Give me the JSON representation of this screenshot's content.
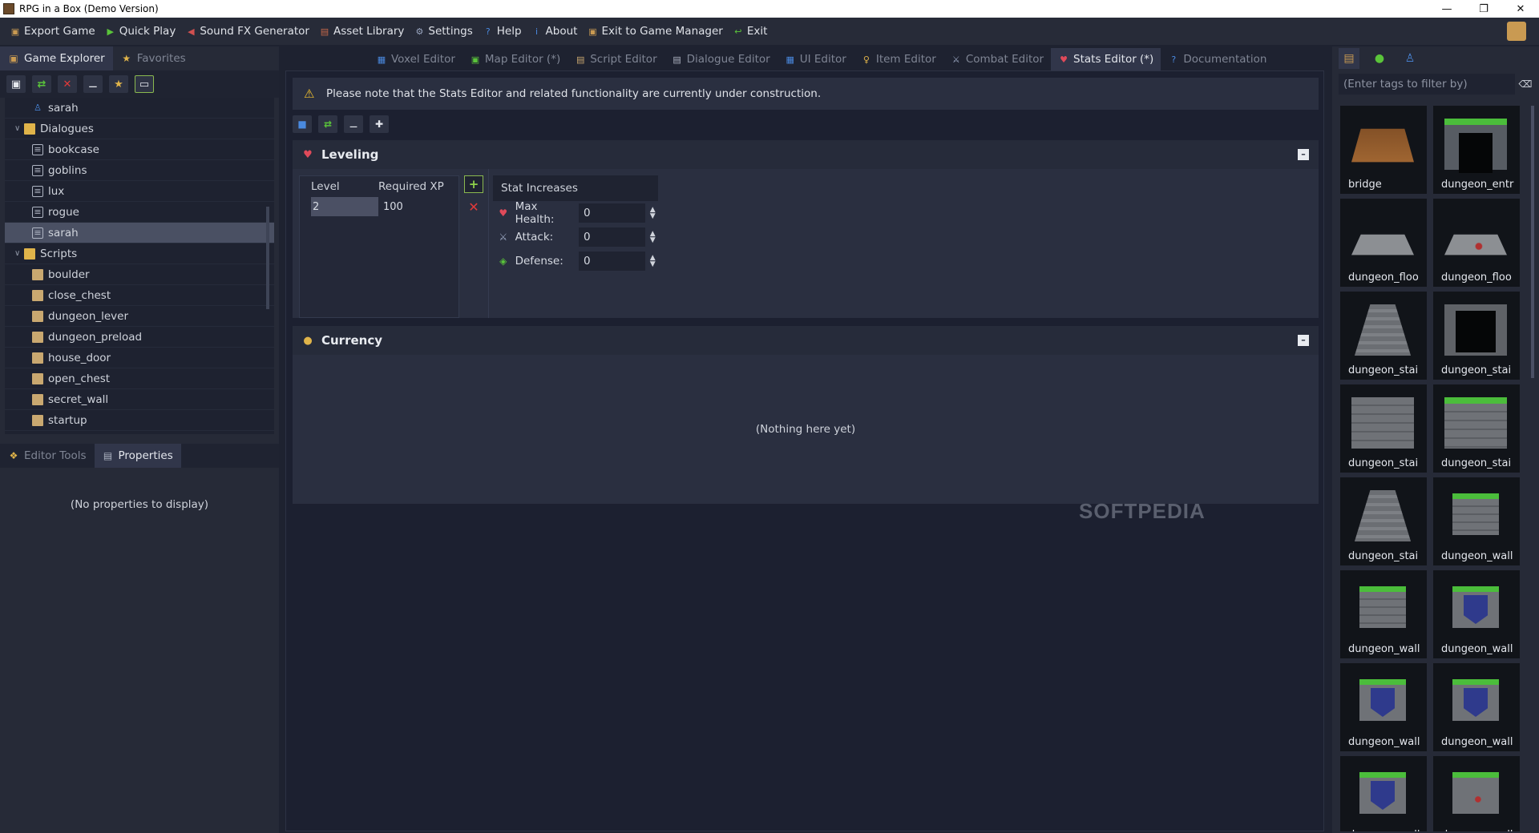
{
  "window": {
    "title": "RPG in a Box (Demo Version)",
    "minimize": "—",
    "maximize": "❐",
    "close": "✕"
  },
  "menu": [
    {
      "label": "Export Game",
      "icon": "export-icon",
      "color": "#c99a52",
      "glyph": "▣"
    },
    {
      "label": "Quick Play",
      "icon": "play-icon",
      "color": "#5ac43a",
      "glyph": "▶"
    },
    {
      "label": "Sound FX Generator",
      "icon": "speaker-icon",
      "color": "#d05050",
      "glyph": "◀"
    },
    {
      "label": "Asset Library",
      "icon": "library-icon",
      "color": "#c96a4a",
      "glyph": "▤"
    },
    {
      "label": "Settings",
      "icon": "gear-icon",
      "color": "#9aa6c0",
      "glyph": "⚙"
    },
    {
      "label": "Help",
      "icon": "help-icon",
      "color": "#4a8ae0",
      "glyph": "?"
    },
    {
      "label": "About",
      "icon": "info-icon",
      "color": "#4a8ae0",
      "glyph": "i"
    },
    {
      "label": "Exit to Game Manager",
      "icon": "exit-manager-icon",
      "color": "#c99a52",
      "glyph": "▣"
    },
    {
      "label": "Exit",
      "icon": "exit-icon",
      "color": "#5ac43a",
      "glyph": "↩"
    }
  ],
  "left_tabs": {
    "explorer": "Game Explorer",
    "favorites": "Favorites"
  },
  "tree": [
    {
      "label": "sarah",
      "type": "character",
      "indent": 2
    },
    {
      "label": "Dialogues",
      "type": "folder",
      "indent": 1
    },
    {
      "label": "bookcase",
      "type": "dialogue",
      "indent": 2
    },
    {
      "label": "goblins",
      "type": "dialogue",
      "indent": 2
    },
    {
      "label": "lux",
      "type": "dialogue",
      "indent": 2
    },
    {
      "label": "rogue",
      "type": "dialogue",
      "indent": 2
    },
    {
      "label": "sarah",
      "type": "dialogue",
      "indent": 2,
      "selected": true
    },
    {
      "label": "Scripts",
      "type": "folder",
      "indent": 1
    },
    {
      "label": "boulder",
      "type": "script",
      "indent": 2
    },
    {
      "label": "close_chest",
      "type": "script",
      "indent": 2
    },
    {
      "label": "dungeon_lever",
      "type": "script",
      "indent": 2
    },
    {
      "label": "dungeon_preload",
      "type": "script",
      "indent": 2
    },
    {
      "label": "house_door",
      "type": "script",
      "indent": 2
    },
    {
      "label": "open_chest",
      "type": "script",
      "indent": 2
    },
    {
      "label": "secret_wall",
      "type": "script",
      "indent": 2
    },
    {
      "label": "startup",
      "type": "script",
      "indent": 2
    }
  ],
  "bottom_tabs": {
    "tools": "Editor Tools",
    "properties": "Properties"
  },
  "properties": {
    "empty": "(No properties to display)"
  },
  "editor_tabs": [
    {
      "label": "Voxel Editor",
      "icon": "voxel-icon",
      "color": "#4a8ae0",
      "glyph": "▦"
    },
    {
      "label": "Map Editor (*)",
      "icon": "map-icon",
      "color": "#5ac43a",
      "glyph": "▣"
    },
    {
      "label": "Script Editor",
      "icon": "script-icon",
      "color": "#c9a870",
      "glyph": "▤"
    },
    {
      "label": "Dialogue Editor",
      "icon": "dialogue-icon",
      "color": "#aeb4c2",
      "glyph": "▤"
    },
    {
      "label": "UI Editor",
      "icon": "ui-icon",
      "color": "#4a8ae0",
      "glyph": "▦"
    },
    {
      "label": "Item Editor",
      "icon": "key-icon",
      "color": "#e0b44a",
      "glyph": "♀"
    },
    {
      "label": "Combat Editor",
      "icon": "sword-icon",
      "color": "#9aa6c0",
      "glyph": "⚔"
    },
    {
      "label": "Stats Editor (*)",
      "icon": "heart-icon",
      "color": "#e04a5a",
      "glyph": "♥",
      "active": true
    },
    {
      "label": "Documentation",
      "icon": "doc-icon",
      "color": "#4a8ae0",
      "glyph": "?"
    }
  ],
  "warning": "Please note that the Stats Editor and related functionality are currently under construction.",
  "leveling": {
    "title": "Leveling",
    "col_level": "Level",
    "col_xp": "Required XP",
    "rows": [
      {
        "level": "2",
        "xp": "100"
      }
    ],
    "stat_header": "Stat Increases",
    "stats": [
      {
        "label": "Max Health:",
        "value": "0",
        "icon": "heart-icon",
        "color": "#e04a5a",
        "glyph": "♥"
      },
      {
        "label": "Attack:",
        "value": "0",
        "icon": "sword-icon",
        "color": "#9aa6c0",
        "glyph": "⚔"
      },
      {
        "label": "Defense:",
        "value": "0",
        "icon": "shield-icon",
        "color": "#5ac43a",
        "glyph": "◈"
      }
    ]
  },
  "currency": {
    "title": "Currency",
    "empty": "(Nothing here yet)"
  },
  "watermark": "SOFTPEDIA",
  "right_panel": {
    "filter_placeholder": "(Enter tags to filter by)",
    "assets": [
      {
        "name": "bridge",
        "kind": "t-bridge"
      },
      {
        "name": "dungeon_entr",
        "kind": "t-entr"
      },
      {
        "name": "dungeon_floo",
        "kind": "t-floor"
      },
      {
        "name": "dungeon_floo",
        "kind": "t-floor-red"
      },
      {
        "name": "dungeon_stai",
        "kind": "t-stair"
      },
      {
        "name": "dungeon_stai",
        "kind": "t-stair-dark"
      },
      {
        "name": "dungeon_stai",
        "kind": "t-wall"
      },
      {
        "name": "dungeon_stai",
        "kind": "t-wall-grass"
      },
      {
        "name": "dungeon_stai",
        "kind": "t-stair"
      },
      {
        "name": "dungeon_wall",
        "kind": "t-wall-small"
      },
      {
        "name": "dungeon_wall",
        "kind": "t-wall-small"
      },
      {
        "name": "dungeon_wall",
        "kind": "t-wall-banner"
      },
      {
        "name": "dungeon_wall",
        "kind": "t-wall-banner"
      },
      {
        "name": "dungeon_wall",
        "kind": "t-wall-banner"
      },
      {
        "name": "dungeon_wall",
        "kind": "t-wall-banner"
      },
      {
        "name": "dungeon_wall",
        "kind": "t-wall-red"
      }
    ]
  }
}
